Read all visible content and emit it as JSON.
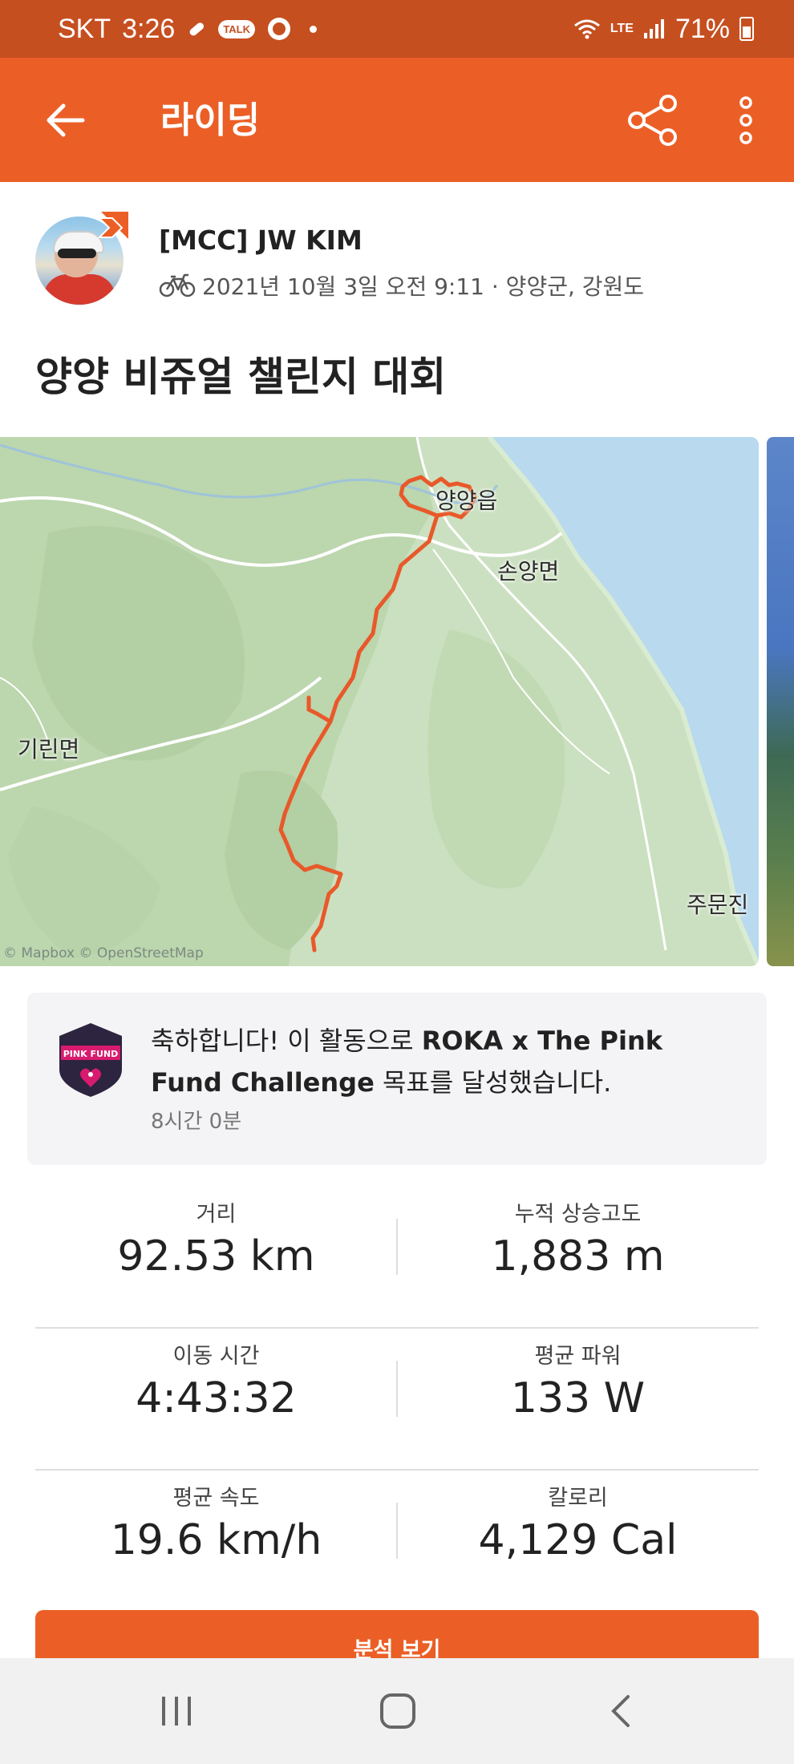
{
  "status_bar": {
    "carrier": "SKT",
    "time": "3:26",
    "talk_badge": "TALK",
    "network": "LTE",
    "battery": "71%"
  },
  "app_bar": {
    "title": "라이딩"
  },
  "activity": {
    "athlete_name": "[MCC] JW KIM",
    "meta": "2021년 10월 3일 오전 9:11 · 양양군, 강원도",
    "title": "양양 비쥬얼 챌린지 대회"
  },
  "map": {
    "labels": [
      "양양읍",
      "손양면",
      "기린면",
      "주문진"
    ],
    "attribution": "© Mapbox © OpenStreetMap",
    "colors": {
      "land": "#cbe0c0",
      "water": "#b8d9ee",
      "route": "#e8592a"
    }
  },
  "achievement": {
    "badge_text": "PINK FUND",
    "message_prefix": "축하합니다! 이 활동으로 ",
    "challenge_name": "ROKA x The Pink Fund Challenge",
    "message_suffix": " 목표를 달성했습니다.",
    "time": "8시간 0분"
  },
  "stats": [
    {
      "left": {
        "label": "거리",
        "value": "92.53 km"
      },
      "right": {
        "label": "누적 상승고도",
        "value": "1,883 m"
      }
    },
    {
      "left": {
        "label": "이동 시간",
        "value": "4:43:32"
      },
      "right": {
        "label": "평균 파워",
        "value": "133 W"
      }
    },
    {
      "left": {
        "label": "평균 속도",
        "value": "19.6 km/h"
      },
      "right": {
        "label": "칼로리",
        "value": "4,129 Cal"
      }
    }
  ],
  "analyze_button": "분석 보기",
  "accent_color": "#eb5f27"
}
